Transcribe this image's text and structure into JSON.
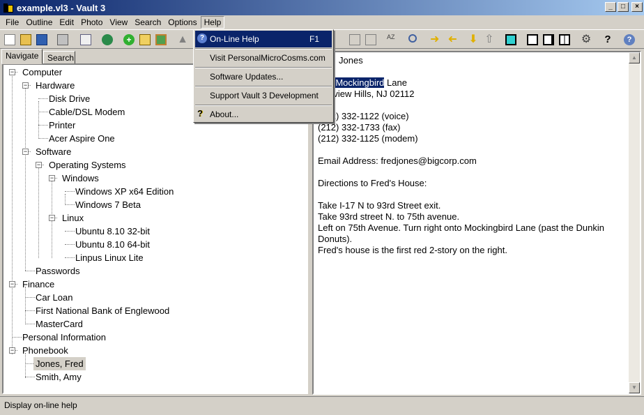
{
  "window": {
    "title": "example.vl3 - Vault 3"
  },
  "menubar": [
    "File",
    "Outline",
    "Edit",
    "Photo",
    "View",
    "Search",
    "Options",
    "Help"
  ],
  "help_menu": {
    "items": [
      {
        "label": "On-Line Help",
        "shortcut": "F1"
      },
      {
        "label": "Visit PersonalMicroCosms.com"
      },
      {
        "label": "Software Updates..."
      },
      {
        "label": "Support Vault 3 Development"
      },
      {
        "label": "About..."
      }
    ]
  },
  "tabs": {
    "navigate": "Navigate",
    "search": "Search"
  },
  "tree": [
    "Computer",
    "Hardware",
    "Disk Drive",
    "Cable/DSL Modem",
    "Printer",
    "Acer Aspire One",
    "Software",
    "Operating Systems",
    "Windows",
    "Windows XP x64 Edition",
    "Windows 7 Beta",
    "Linux",
    "Ubuntu 8.10 32-bit",
    "Ubuntu 8.10 64-bit",
    "Linpus Linux Lite",
    "Passwords",
    "Finance",
    "Car Loan",
    "First National Bank of Englewood",
    "MasterCard",
    "Personal Information",
    "Phonebook",
    "Jones, Fred",
    "Smith, Amy"
  ],
  "note": {
    "line1": "Jones",
    "addr_prefix": "3",
    "addr_highlight": "Mockingbird",
    "addr_suffix": " Lane",
    "city": "rview Hills, NJ  02112",
    "phone1": "(212) 332-1122 (voice)",
    "phone2": "(212) 332-1733 (fax)",
    "phone3": "(212) 332-1125 (modem)",
    "email": "Email Address:  fredjones@bigcorp.com",
    "directions_title": "Directions to Fred's House:",
    "dir1": "Take I-17 N to 93rd Street exit.",
    "dir2": "Take 93rd street N. to 75th avenue.",
    "dir3": "Left on 75th Avenue.  Turn right onto Mockingbird Lane (past the Dunkin",
    "dir4": "Donuts).",
    "dir5": "Fred's house is the first red 2-story on the right."
  },
  "status": "Display on-line help",
  "colors": {
    "selection": "#0a246a",
    "titlebar_start": "#0a246a",
    "titlebar_end": "#a6caf0"
  }
}
